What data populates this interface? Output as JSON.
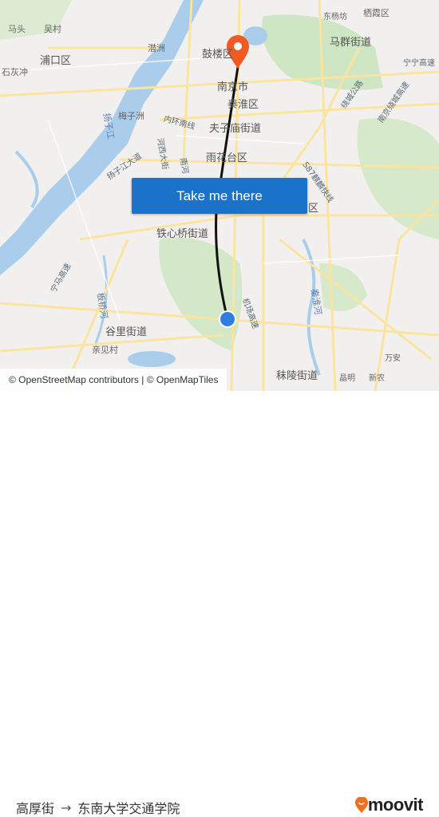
{
  "map": {
    "labels": [
      "马头",
      "吴村",
      "浦口区",
      "石灰冲",
      "潜洲",
      "梅子洲",
      "扬子江",
      "鼓楼区",
      "南京市",
      "秦淮区",
      "夫子庙街道",
      "雨花台区",
      "铁心桥街道",
      "谷里街道",
      "亲见村",
      "秣陵街道",
      "晶明",
      "新农",
      "万安",
      "马群街道",
      "东杨坊",
      "栖霞区",
      "区",
      "秦淮河",
      "板桥河",
      "河西大街",
      "南河",
      "内环南线",
      "扬子江大道",
      "绕城公路",
      "S87麒麟快线",
      "机场高速",
      "宁宁高速",
      "南京绕城高速",
      "宁马高速"
    ],
    "colors": {
      "water": "#a9cdea",
      "park": "#cfe6c4",
      "road": "#fbe9a6",
      "route": "#111111",
      "origin": "#2f7de1",
      "destination": "#f25a23"
    }
  },
  "cta": {
    "label": "Take me there"
  },
  "attribution": "© OpenStreetMap contributors | © OpenMapTiles",
  "footer": {
    "origin": "高厚街",
    "arrow": "→",
    "destination": "东南大学交通学院"
  },
  "brand": {
    "name": "moovit",
    "color": "#f26c22"
  }
}
